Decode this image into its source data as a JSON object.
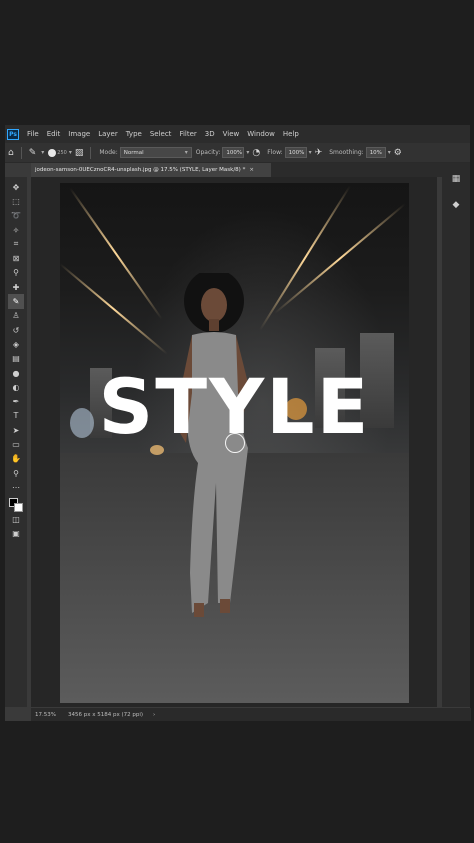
{
  "menu": {
    "logo": "Ps",
    "items": [
      "File",
      "Edit",
      "Image",
      "Layer",
      "Type",
      "Select",
      "Filter",
      "3D",
      "View",
      "Window",
      "Help"
    ]
  },
  "options_bar": {
    "brush_size": "250",
    "mode_label": "Mode:",
    "mode_value": "Normal",
    "opacity_label": "Opacity:",
    "opacity_value": "100%",
    "flow_label": "Flow:",
    "flow_value": "100%",
    "smoothing_label": "Smoothing:",
    "smoothing_value": "10%"
  },
  "document": {
    "tab_title": "jodeon-samson-0UECznoCR4-unsplash.jpg @ 17.5% (STYLE, Layer Mask/8) *",
    "tab_close": "×"
  },
  "canvas": {
    "overlay_text": "STYLE"
  },
  "status": {
    "zoom": "17.53%",
    "doc_size": "3456 px x 5184 px (72 ppi)",
    "arrow": "›"
  },
  "colors": {
    "accent": "#31a8ff",
    "foreground": "#000000",
    "background": "#ffffff"
  }
}
